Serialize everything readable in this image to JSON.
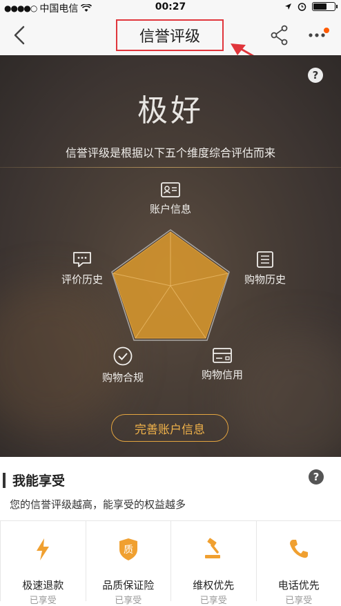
{
  "status_bar": {
    "carrier": "中国电信",
    "time": "00:27"
  },
  "nav": {
    "title": "信誉评级"
  },
  "hero": {
    "rating": "极好",
    "description": "信誉评级是根据以下五个维度综合评估而来",
    "dimensions": [
      {
        "label": "账户信息",
        "icon": "id-card-icon"
      },
      {
        "label": "购物历史",
        "icon": "list-icon"
      },
      {
        "label": "购物信用",
        "icon": "credit-card-icon"
      },
      {
        "label": "购物合规",
        "icon": "check-circle-icon"
      },
      {
        "label": "评价历史",
        "icon": "comment-icon"
      }
    ],
    "cta": "完善账户信息"
  },
  "benefits": {
    "title": "我能享受",
    "subtitle": "您的信誉评级越高，能享受的权益越多",
    "items": [
      {
        "label": "极速退款",
        "status": "已享受",
        "icon": "lightning-icon"
      },
      {
        "label": "品质保证险",
        "status": "已享受",
        "icon": "quality-badge-icon"
      },
      {
        "label": "维权优先",
        "status": "已享受",
        "icon": "gavel-icon"
      },
      {
        "label": "电话优先",
        "status": "已享受",
        "icon": "phone-icon"
      }
    ]
  },
  "colors": {
    "accent": "#F0A030",
    "highlight_box": "#E0353B",
    "badge_dot": "#FF5A00"
  }
}
